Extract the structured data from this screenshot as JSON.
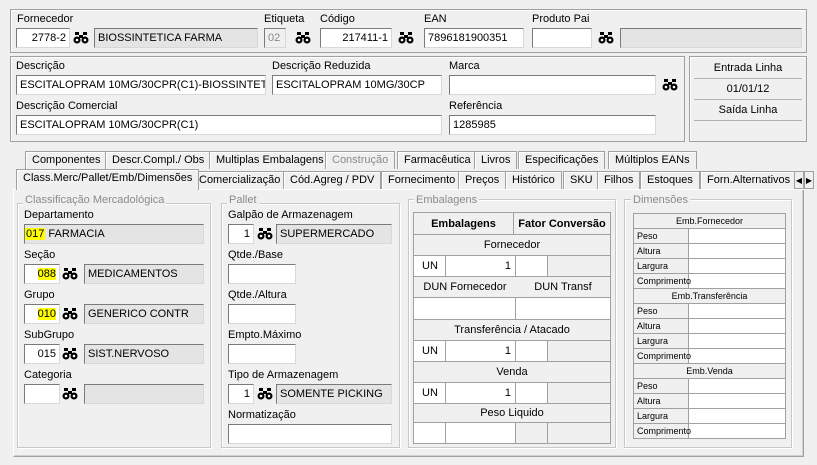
{
  "header": {
    "fornecedor_label": "Fornecedor",
    "fornecedor_code": "2778-2",
    "fornecedor_name": "BIOSSINTETICA FARMA",
    "etiqueta_label": "Etiqueta",
    "etiqueta_value": "02",
    "codigo_label": "Código",
    "codigo_value": "217411-1",
    "ean_label": "EAN",
    "ean_value": "7896181900351",
    "produto_pai_label": "Produto Pai",
    "produto_pai_value": "",
    "produto_pai_desc": ""
  },
  "desc": {
    "descricao_label": "Descrição",
    "descricao_value": "ESCITALOPRAM 10MG/30CPR(C1)-BIOSSINTETIC",
    "descricao_reduzida_label": "Descrição Reduzida",
    "descricao_reduzida_value": "ESCITALOPRAM 10MG/30CP",
    "marca_label": "Marca",
    "marca_value": "",
    "descricao_comercial_label": "Descrição Comercial",
    "descricao_comercial_value": "ESCITALOPRAM 10MG/30CPR(C1)",
    "referencia_label": "Referência",
    "referencia_value": "1285985"
  },
  "linha": {
    "entrada_label": "Entrada Linha",
    "entrada_value": "01/01/12",
    "saida_label": "Saída Linha",
    "saida_value": ""
  },
  "tabs_row1": [
    "Componentes",
    "Descr.Compl./ Obs",
    "Multiplas Embalagens",
    "Construção",
    "Farmacêutica",
    "Livros",
    "Especificações",
    "Múltiplos EANs"
  ],
  "tabs_row2": [
    "Class.Merc/Pallet/Emb/Dimensões",
    "Comercialização",
    "Cód.Agreg / PDV",
    "Fornecimento",
    "Preços",
    "Histórico",
    "SKU",
    "Filhos",
    "Estoques",
    "Forn.Alternativos"
  ],
  "classificacao": {
    "title": "Classificação Mercadológica",
    "departamento_label": "Departamento",
    "departamento_code": "017",
    "departamento_name": "FARMACIA",
    "secao_label": "Seção",
    "secao_code": "088",
    "secao_name": "MEDICAMENTOS",
    "grupo_label": "Grupo",
    "grupo_code": "010",
    "grupo_name": "GENERICO CONTR",
    "subgrupo_label": "SubGrupo",
    "subgrupo_code": "015",
    "subgrupo_name": "SIST.NERVOSO",
    "categoria_label": "Categoria",
    "categoria_code": "",
    "categoria_name": ""
  },
  "pallet": {
    "title": "Pallet",
    "galpao_label": "Galpão de Armazenagem",
    "galpao_code": "1",
    "galpao_name": "SUPERMERCADO",
    "qtde_base_label": "Qtde./Base",
    "qtde_base_value": "",
    "qtde_altura_label": "Qtde./Altura",
    "qtde_altura_value": "",
    "empto_label": "Empto.Máximo",
    "empto_value": "",
    "tipo_label": "Tipo de Armazenagem",
    "tipo_code": "1",
    "tipo_name": "SOMENTE PICKING",
    "normatizacao_label": "Normatização",
    "normatizacao_value": ""
  },
  "embalagens": {
    "title": "Embalagens",
    "col1": "Embalagens",
    "col2": "Fator Conversão",
    "fornecedor": "Fornecedor",
    "un1": "UN",
    "un1_val": "1",
    "dun_fornecedor": "DUN Fornecedor",
    "dun_transf": "DUN Transf",
    "transferencia": "Transferência / Atacado",
    "un2": "UN",
    "un2_val": "1",
    "venda": "Venda",
    "un3": "UN",
    "un3_val": "1",
    "peso_liquido": "Peso Liquido"
  },
  "dimensoes": {
    "title": "Dimensões",
    "sections": [
      {
        "title": "Emb.Fornecedor",
        "rows": [
          "Peso",
          "Altura",
          "Largura",
          "Comprimento"
        ]
      },
      {
        "title": "Emb.Transferência",
        "rows": [
          "Peso",
          "Altura",
          "Largura",
          "Comprimento"
        ]
      },
      {
        "title": "Emb.Venda",
        "rows": [
          "Peso",
          "Altura",
          "Largura",
          "Comprimento"
        ]
      }
    ]
  },
  "icons": {
    "lookup": "binoculars-icon",
    "tab_scroll_left": "arrow-left-icon",
    "tab_scroll_right": "arrow-right-icon"
  },
  "colors": {
    "highlight": "#ffff00",
    "readonly_bg": "#e4e4e4",
    "window_bg": "#f0f0f0"
  }
}
